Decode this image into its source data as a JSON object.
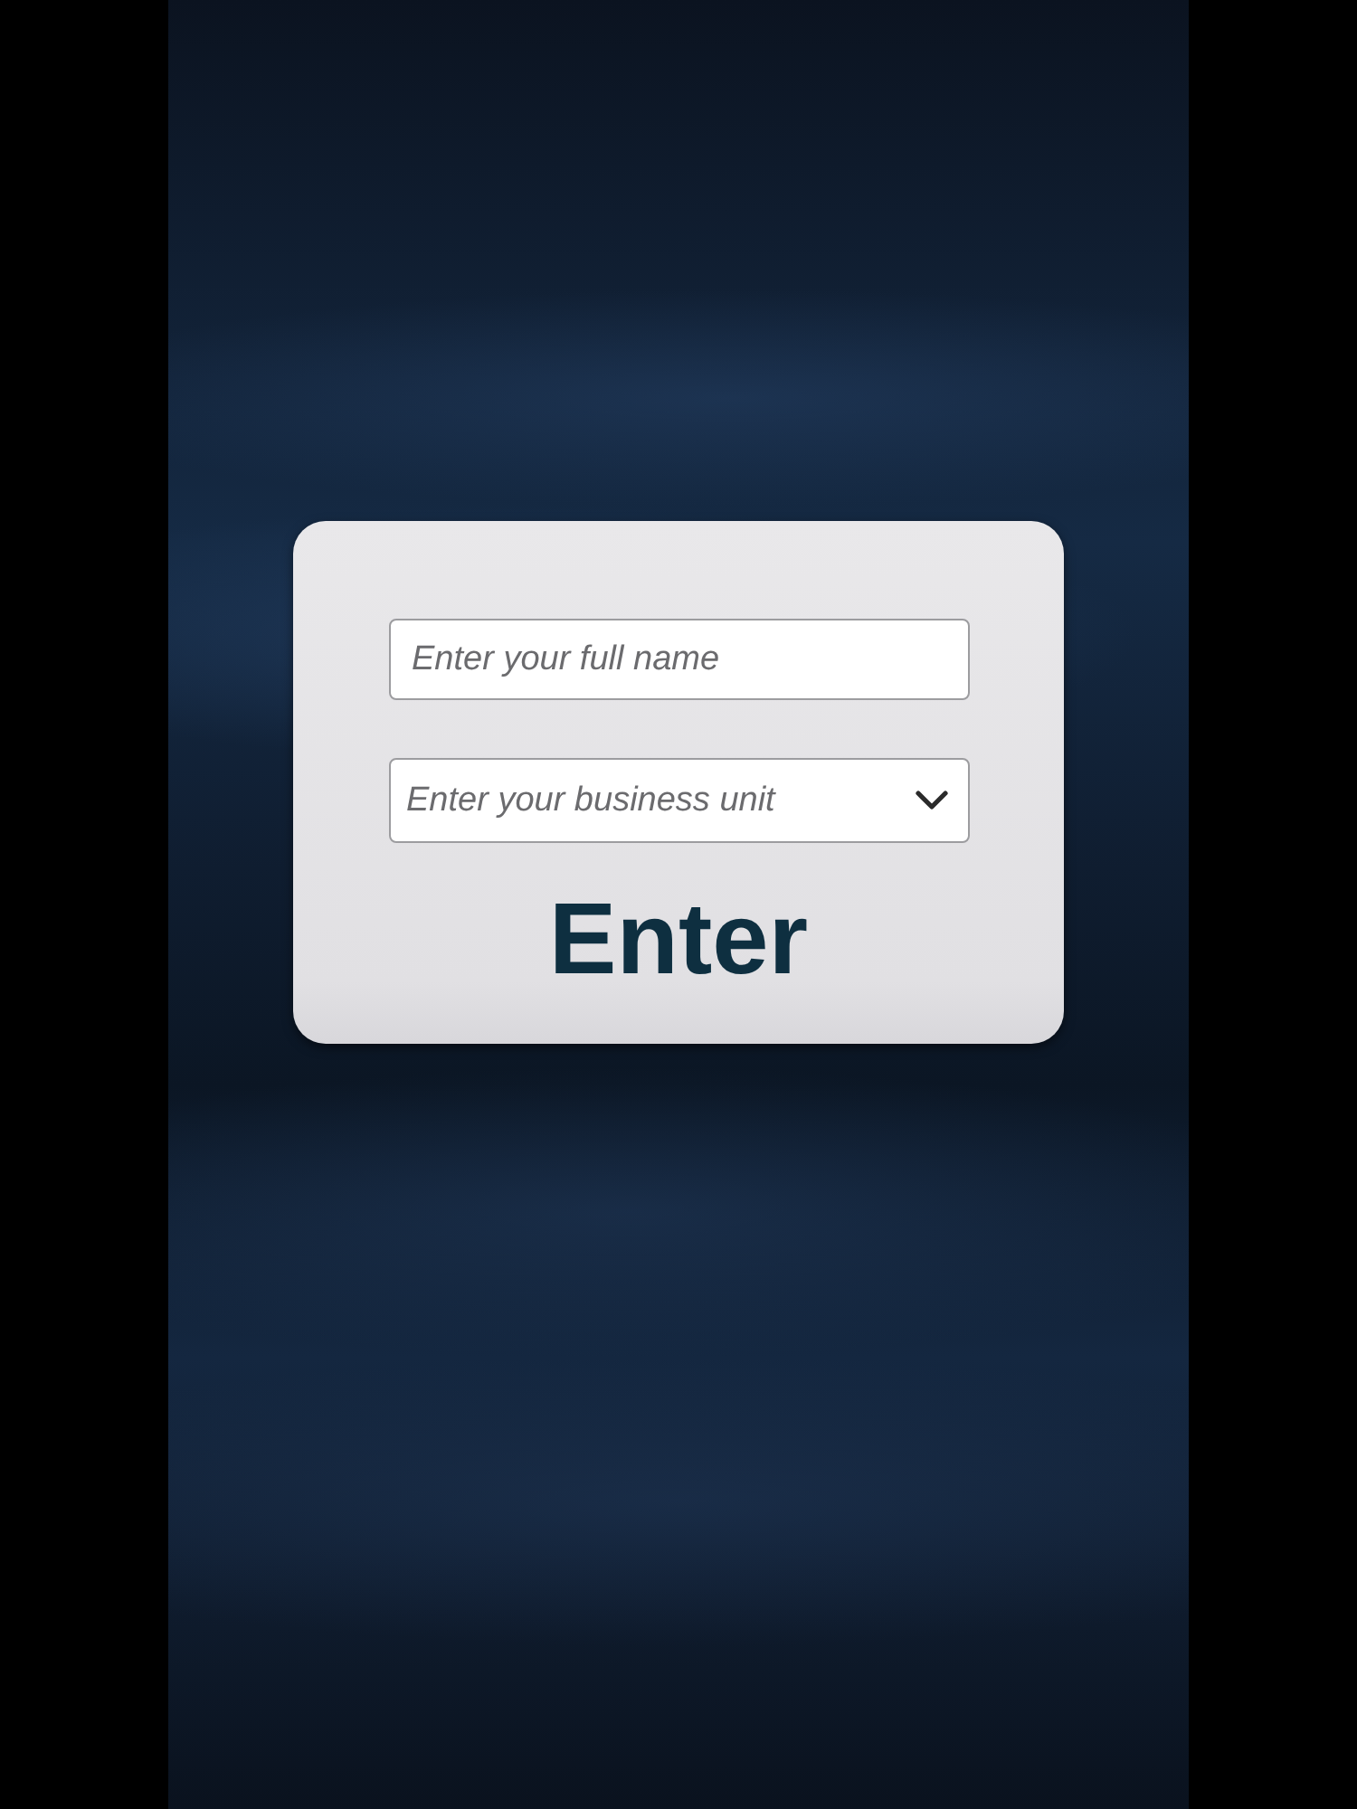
{
  "form": {
    "name_field": {
      "placeholder": "Enter your full name"
    },
    "business_unit_field": {
      "placeholder": "Enter your business unit"
    },
    "submit_button": {
      "label": "Enter"
    }
  }
}
